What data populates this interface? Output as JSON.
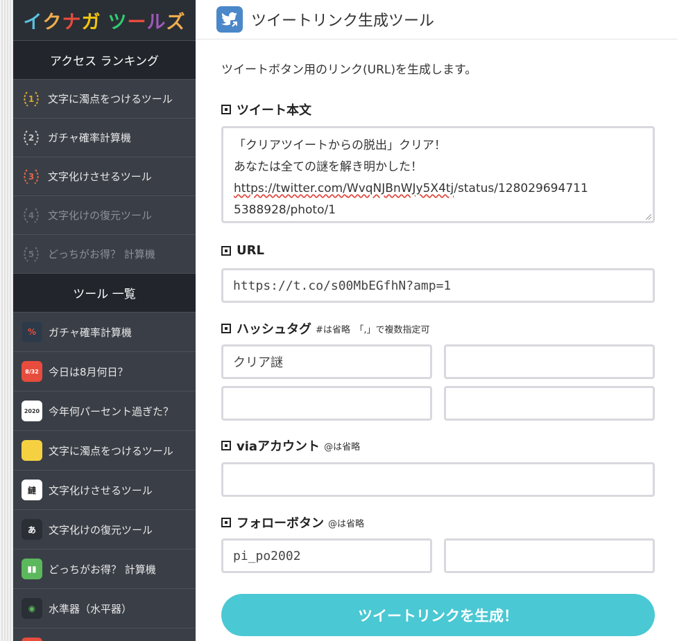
{
  "sidebar": {
    "logo": {
      "text": "イクナガ ツールズ",
      "chars": [
        "イ",
        "ク",
        "ナ",
        "ガ",
        " ",
        "ツ",
        "ー",
        "ル",
        "ズ"
      ],
      "colors": [
        "#5bc0de",
        "#f0ad4e",
        "#e84c3d",
        "#f1c40f",
        "#fff",
        "#2ecc71",
        "#e84c3d",
        "#9b59b6",
        "#f0ad4e"
      ]
    },
    "ranking_heading": "アクセス ランキング",
    "ranking": [
      {
        "rank": "1",
        "label": "文字に濁点をつけるツール",
        "color": "#e0a82e"
      },
      {
        "rank": "2",
        "label": "ガチャ確率計算機",
        "color": "#c8c8c8"
      },
      {
        "rank": "3",
        "label": "文字化けさせるツール",
        "color": "#e2674a"
      },
      {
        "rank": "4",
        "label": "文字化けの復元ツール",
        "color": "#6c7179"
      },
      {
        "rank": "5",
        "label": "どっちがお得？ 計算機",
        "color": "#6c7179"
      }
    ],
    "tools_heading": "ツール 一覧",
    "tools": [
      {
        "label": "ガチャ確率計算機",
        "icon": "gacha-icon",
        "glyph": "%",
        "bg": "#2d3a4a",
        "fg": "#e84c3d"
      },
      {
        "label": "今日は8月何日？",
        "icon": "calendar-icon",
        "glyph": "8/32",
        "bg": "#e84c3d",
        "fg": "#fff"
      },
      {
        "label": "今年何パーセント過ぎた？",
        "icon": "year-percent-icon",
        "glyph": "2020",
        "bg": "#fff",
        "fg": "#333"
      },
      {
        "label": "文字に濁点をつけるツール",
        "icon": "note-icon",
        "glyph": "",
        "bg": "#f5d142",
        "fg": "#e84c3d"
      },
      {
        "label": "文字化けさせるツール",
        "icon": "garble-icon",
        "glyph": "縺",
        "bg": "#fff",
        "fg": "#222"
      },
      {
        "label": "文字化けの復元ツール",
        "icon": "restore-icon",
        "glyph": "あ",
        "bg": "#2a2e35",
        "fg": "#fff"
      },
      {
        "label": "どっちがお得？ 計算機",
        "icon": "compare-icon",
        "glyph": "▮▮",
        "bg": "#5cb85c",
        "fg": "#fff"
      },
      {
        "label": "水準器（水平器）",
        "icon": "level-icon",
        "glyph": "◉",
        "bg": "#2a2e35",
        "fg": "#5cb85c"
      },
      {
        "label": "",
        "icon": "next-tool-icon",
        "glyph": "",
        "bg": "#e84c3d",
        "fg": "#fff"
      }
    ]
  },
  "header": {
    "title": "ツイートリンク生成ツール"
  },
  "intro": "ツイートボタン用のリンク(URL)を生成します。",
  "tweet_body": {
    "label": "ツイート本文",
    "lines": [
      "「クリアツイートからの脱出」クリア！",
      "あなたは全ての謎を解き明かした！"
    ],
    "url_prefix": "https://twitter.com/",
    "url_underlined": "WvqNJBnWJy5X4tj",
    "url_suffix": "/status/128029694711",
    "last_line": "5388928/photo/1"
  },
  "url_field": {
    "label": "URL",
    "value": "https://t.co/s00MbEGfhN?amp=1"
  },
  "hashtag": {
    "label": "ハッシュタグ",
    "note": "#は省略　「,」で複数指定可",
    "values": [
      "クリア謎",
      "",
      "",
      ""
    ]
  },
  "via": {
    "label": "viaアカウント",
    "note": "@は省略",
    "value": ""
  },
  "follow": {
    "label": "フォローボタン",
    "note": "@は省略",
    "values": [
      "pi_po2002",
      ""
    ]
  },
  "submit_label": "ツイートリンクを生成！"
}
